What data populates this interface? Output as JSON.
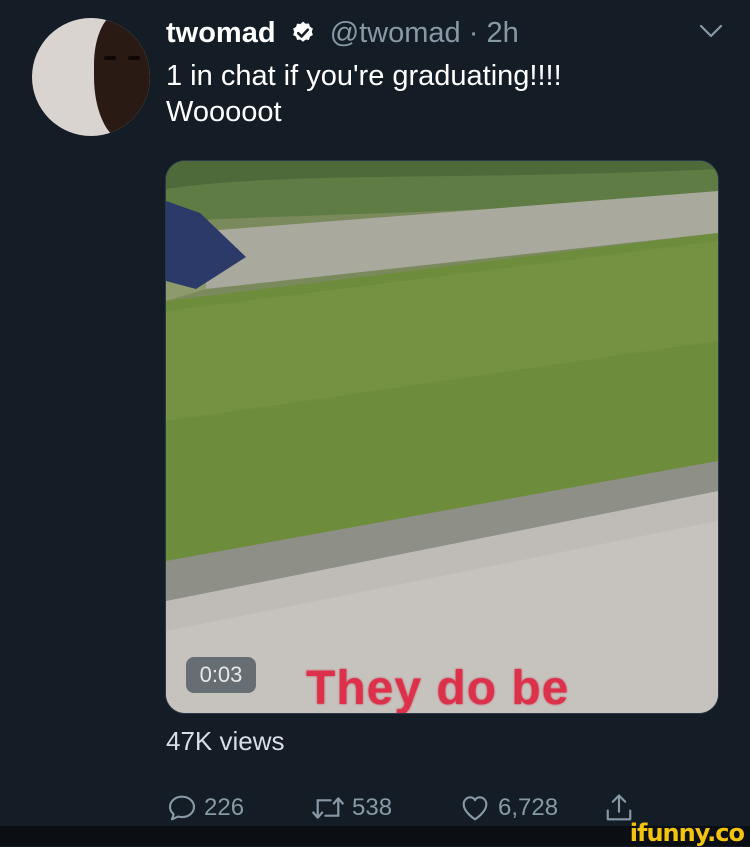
{
  "tweet": {
    "display_name": "twomad",
    "handle": "@twomad",
    "separator": "·",
    "time": "2h",
    "text": "1 in chat if you're graduating!!!!\nWooooot"
  },
  "media": {
    "duration": "0:03",
    "caption": "They do be"
  },
  "stats": {
    "views": "47K views",
    "replies": "226",
    "retweets": "538",
    "likes": "6,728"
  },
  "watermark": "ifunny.co",
  "icons": {
    "verified": "verified-badge-icon",
    "menu": "chevron-down-icon",
    "reply": "reply-icon",
    "retweet": "retweet-icon",
    "like": "heart-icon",
    "share": "share-icon"
  },
  "colors": {
    "background": "#141d26",
    "secondary_text": "#8899a6",
    "watermark": "#f2c30f",
    "caption": "#e0223f"
  }
}
